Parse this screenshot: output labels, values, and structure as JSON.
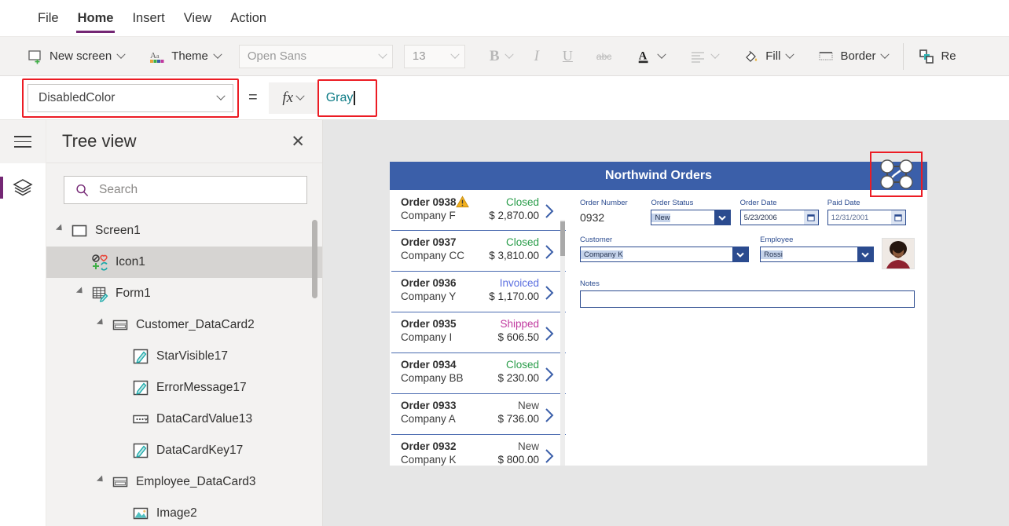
{
  "menubar": {
    "items": [
      {
        "label": "File",
        "active": false
      },
      {
        "label": "Home",
        "active": true
      },
      {
        "label": "Insert",
        "active": false
      },
      {
        "label": "View",
        "active": false
      },
      {
        "label": "Action",
        "active": false
      }
    ]
  },
  "toolbar": {
    "new_screen": "New screen",
    "theme": "Theme",
    "font_family": "Open Sans",
    "font_size": "13",
    "bold": "B",
    "italic": "I",
    "underline": "U",
    "strikethrough": "abc",
    "font_color": "A",
    "align": "align-left",
    "fill": "Fill",
    "border": "Border",
    "reorder": "Re"
  },
  "formulabar": {
    "property": "DisabledColor",
    "equals": "=",
    "fx": "fx",
    "formula": "Gray",
    "highlight_color": "#ec1c24",
    "formula_text_color": "#0e7c86"
  },
  "rail": {
    "menu": "hamburger-menu",
    "tree_view_button": "layers",
    "accent": "#742774"
  },
  "treeview": {
    "title": "Tree view",
    "close": "✕",
    "search_placeholder": "Search",
    "items": [
      {
        "label": "Screen1",
        "depth": 0,
        "icon": "screen",
        "twisty": true,
        "selected": false
      },
      {
        "label": "Icon1",
        "depth": 1,
        "icon": "icon-multi",
        "twisty": false,
        "selected": true
      },
      {
        "label": "Form1",
        "depth": 1,
        "icon": "form",
        "twisty": true,
        "selected": false
      },
      {
        "label": "Customer_DataCard2",
        "depth": 2,
        "icon": "datacard",
        "twisty": true,
        "selected": false
      },
      {
        "label": "StarVisible17",
        "depth": 3,
        "icon": "pencil",
        "twisty": false,
        "selected": false
      },
      {
        "label": "ErrorMessage17",
        "depth": 3,
        "icon": "pencil",
        "twisty": false,
        "selected": false
      },
      {
        "label": "DataCardValue13",
        "depth": 3,
        "icon": "dropdown",
        "twisty": false,
        "selected": false
      },
      {
        "label": "DataCardKey17",
        "depth": 3,
        "icon": "pencil",
        "twisty": false,
        "selected": false
      },
      {
        "label": "Employee_DataCard3",
        "depth": 2,
        "icon": "datacard",
        "twisty": true,
        "selected": false
      },
      {
        "label": "Image2",
        "depth": 3,
        "icon": "image",
        "twisty": false,
        "selected": false
      }
    ]
  },
  "canvas": {
    "app_title": "Northwind Orders",
    "header_color": "#3b5fa9",
    "selected_control_icon": "network-nodes-icon",
    "gallery": [
      {
        "order": "Order 0938",
        "company": "Company F",
        "status": "Closed",
        "status_color": "#2a9d4a",
        "amount": "$ 2,870.00",
        "warning": true
      },
      {
        "order": "Order 0937",
        "company": "Company CC",
        "status": "Closed",
        "status_color": "#2a9d4a",
        "amount": "$ 3,810.00",
        "warning": false
      },
      {
        "order": "Order 0936",
        "company": "Company Y",
        "status": "Invoiced",
        "status_color": "#5b6fe0",
        "amount": "$ 1,170.00",
        "warning": false
      },
      {
        "order": "Order 0935",
        "company": "Company I",
        "status": "Shipped",
        "status_color": "#c0399f",
        "amount": "$ 606.50",
        "warning": false
      },
      {
        "order": "Order 0934",
        "company": "Company BB",
        "status": "Closed",
        "status_color": "#2a9d4a",
        "amount": "$ 230.00",
        "warning": false
      },
      {
        "order": "Order 0933",
        "company": "Company A",
        "status": "New",
        "status_color": "#4a4a4a",
        "amount": "$ 736.00",
        "warning": false
      },
      {
        "order": "Order 0932",
        "company": "Company K",
        "status": "New",
        "status_color": "#4a4a4a",
        "amount": "$ 800.00",
        "warning": false
      }
    ],
    "form": {
      "order_number_label": "Order Number",
      "order_number_value": "0932",
      "order_status_label": "Order Status",
      "order_status_value": "New",
      "order_date_label": "Order Date",
      "order_date_value": "5/23/2006",
      "paid_date_label": "Paid Date",
      "paid_date_value": "12/31/2001",
      "customer_label": "Customer",
      "customer_value": "Company K",
      "employee_label": "Employee",
      "employee_value": "Rossi",
      "notes_label": "Notes",
      "notes_value": ""
    }
  }
}
